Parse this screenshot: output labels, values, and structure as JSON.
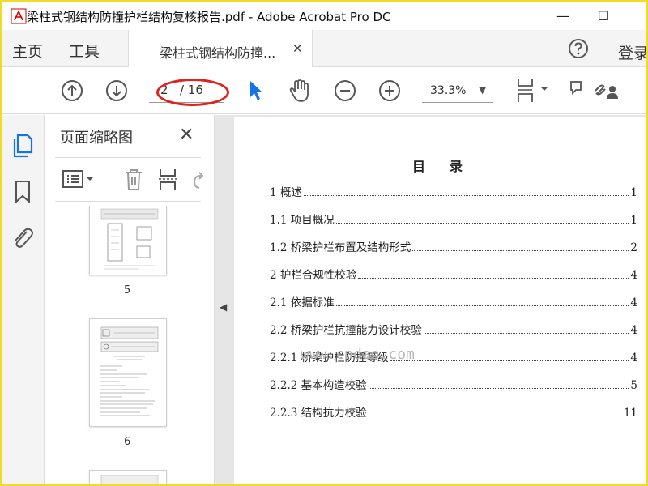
{
  "window": {
    "title": "梁柱式钢结构防撞护栏结构复核报告.pdf - Adobe Acrobat Pro DC",
    "minimize_label": "—",
    "maximize_label": "☐"
  },
  "tabs": {
    "home": "主页",
    "tools": "工具",
    "document": "梁柱式钢结构防撞...",
    "document_close": "✕",
    "login": "登录"
  },
  "toolbar": {
    "current_page": "2",
    "page_total": "/ 16",
    "zoom": "33.3%",
    "zoom_caret": "▼",
    "highlight_color": "#e0231e"
  },
  "thumbnails": {
    "title": "页面缩略图",
    "close": "✕",
    "pages": [
      {
        "number": "5"
      },
      {
        "number": "6"
      }
    ]
  },
  "document": {
    "toc_title": "目录",
    "entries": [
      {
        "label": "1  概述",
        "page": "1"
      },
      {
        "label": "1.1  项目概况",
        "page": "1"
      },
      {
        "label": "1.2  桥梁护栏布置及结构形式",
        "page": "2"
      },
      {
        "label": "2  护栏合规性校验",
        "page": "4"
      },
      {
        "label": "2.1  依据标准",
        "page": "4"
      },
      {
        "label": "2.2  桥梁护栏抗撞能力设计校验",
        "page": "4"
      },
      {
        "label": "2.2.1  桥梁护栏防撞等级",
        "page": "4"
      },
      {
        "label": "2.2.2  基本构造校验",
        "page": "5"
      },
      {
        "label": "2.2.3  结构抗力校验",
        "page": "11"
      }
    ]
  },
  "watermark": "www.cndao.com",
  "colors": {
    "frame": "#f0dc28",
    "accent_blue": "#1473e6",
    "panel_bg": "#f4f4f4",
    "viewer_bg": "#e6e6e6"
  }
}
